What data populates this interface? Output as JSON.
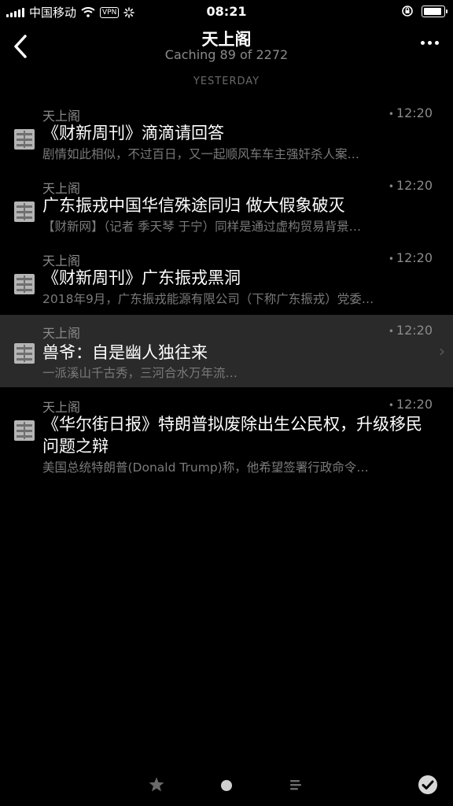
{
  "status_bar": {
    "carrier": "中国移动",
    "vpn": "VPN",
    "time": "08:21"
  },
  "nav": {
    "title": "天上阁",
    "subtitle": "Caching 89 of 2272"
  },
  "section_label": "YESTERDAY",
  "articles": [
    {
      "source": "天上阁",
      "time": "12:20",
      "title": "《财新周刊》滴滴请回答",
      "summary": "剧情如此相似，不过百日，又一起顺风车车主强奸杀人案…"
    },
    {
      "source": "天上阁",
      "time": "12:20",
      "title": "广东振戎中国华信殊途同归 做大假象破灭",
      "summary": "【财新网】（记者 季天琴 于宁）同样是通过虚构贸易背景…"
    },
    {
      "source": "天上阁",
      "time": "12:20",
      "title": "《财新周刊》广东振戎黑洞",
      "summary": "2018年9月，广东振戎能源有限公司（下称广东振戎）党委…"
    },
    {
      "source": "天上阁",
      "time": "12:20",
      "title": "兽爷：自是幽人独往来",
      "summary": "一派溪山千古秀，三河合水万年流…"
    },
    {
      "source": "天上阁",
      "time": "12:20",
      "title": "《华尔街日报》特朗普拟废除出生公民权，升级移民问题之辩",
      "summary": "美国总统特朗普(Donald Trump)称，他希望签署行政命令…"
    }
  ],
  "colors": {
    "background": "#000000",
    "selected_row": "#2a2a2a",
    "muted_text": "#8a8a8a"
  }
}
